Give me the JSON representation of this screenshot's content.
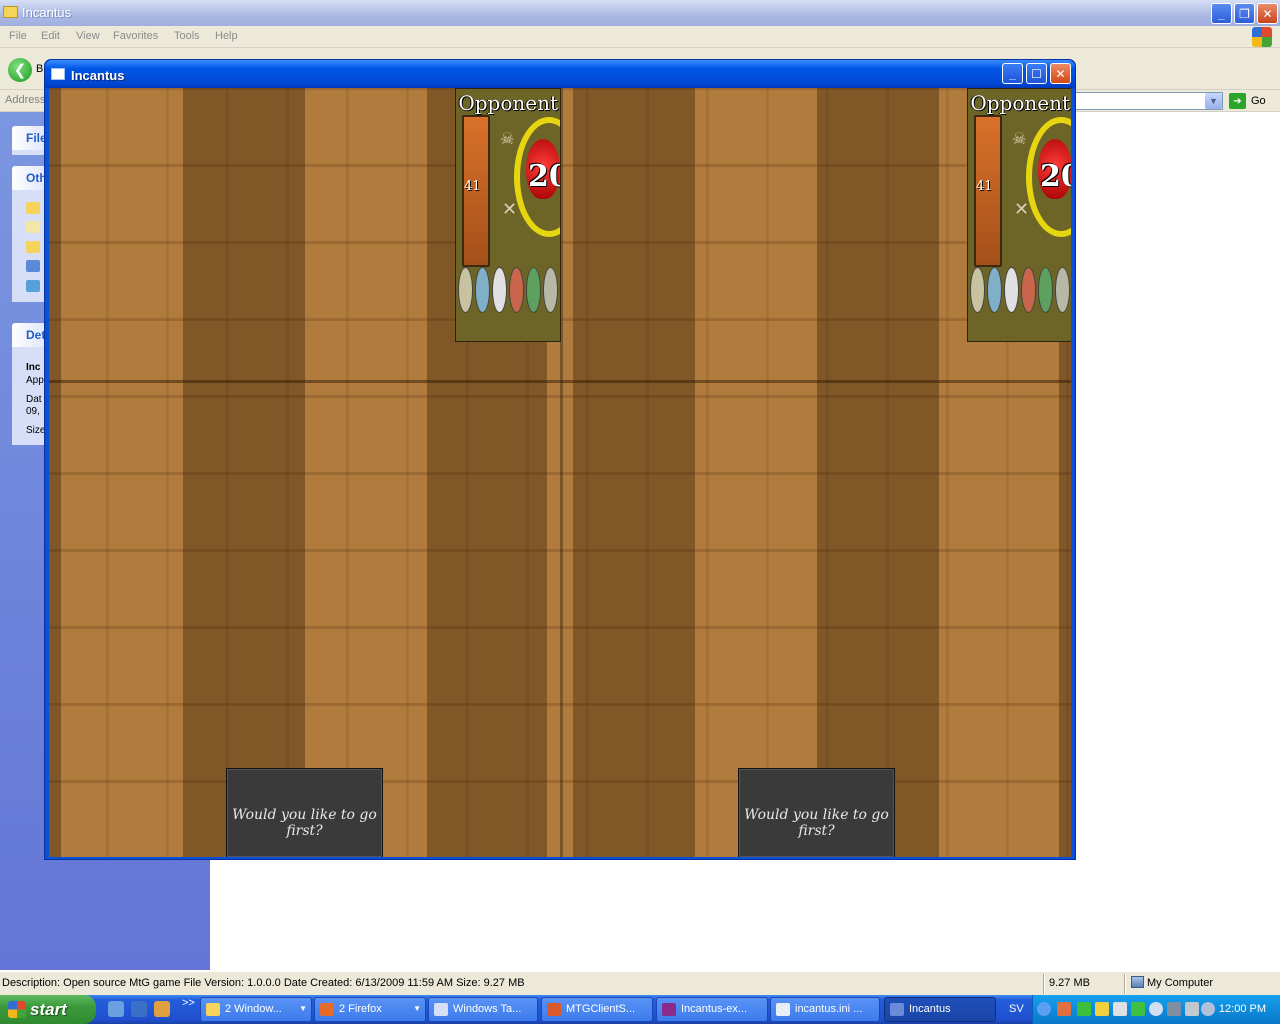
{
  "explorer": {
    "title": "Incantus",
    "menu": [
      "File",
      "Edit",
      "View",
      "Favorites",
      "Tools",
      "Help"
    ],
    "toolbar": {
      "back_label": "B"
    },
    "address": {
      "label": "Address",
      "go_label": "Go"
    },
    "taskpane": {
      "file_tasks_header": "File",
      "other_places_header": "Oth",
      "details_header": "Det",
      "details_lines": [
        "Inc",
        "App",
        "Dat",
        "09,",
        "Size"
      ]
    },
    "status": {
      "description": "Description: Open source MtG game File Version: 1.0.0.0 Date Created: 6/13/2009 11:59 AM Size: 9.27 MB",
      "size": "9.27 MB",
      "location": "My Computer"
    }
  },
  "game": {
    "title": "Incantus",
    "panels": [
      {
        "opponent_label": "Opponent",
        "library_count": "41",
        "life": "20"
      },
      {
        "opponent_label": "Opponent",
        "library_count": "41",
        "life": "20"
      }
    ],
    "prompts": [
      "Would you like to go first?",
      "Would you like to go first?"
    ],
    "mana_colors": [
      "#c9c2a0",
      "#7fb0c8",
      "#e0e0e0",
      "#c9654a",
      "#5ea05e",
      "#b8b8a8"
    ]
  },
  "taskbar": {
    "start_label": "start",
    "more": ">>",
    "tasks": [
      {
        "label": "2 Window...",
        "color": "#f6d35b",
        "group": true
      },
      {
        "label": "2 Firefox",
        "color": "#e66a2a",
        "group": true
      },
      {
        "label": "Windows Ta...",
        "color": "#d6dff7",
        "group": false
      },
      {
        "label": "MTGClientS...",
        "color": "#d85a2a",
        "group": false
      },
      {
        "label": "Incantus-ex...",
        "color": "#8a2a8a",
        "group": false
      },
      {
        "label": "incantus.ini ...",
        "color": "#e8eef8",
        "group": false
      },
      {
        "label": "Incantus",
        "color": "#6a8cd8",
        "group": false,
        "active": true
      }
    ],
    "language": "SV",
    "clock": "12:00 PM"
  }
}
